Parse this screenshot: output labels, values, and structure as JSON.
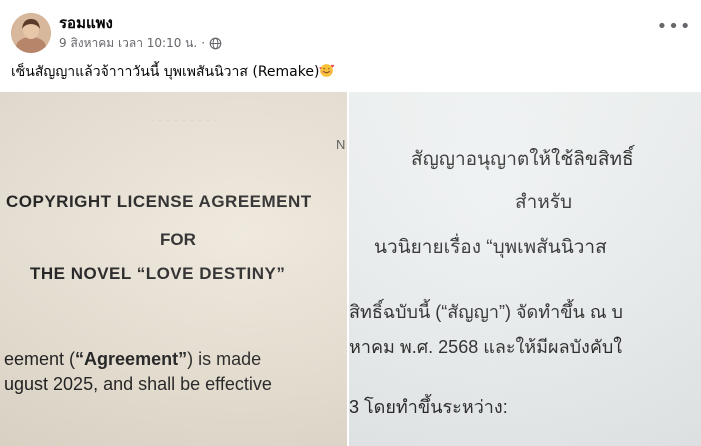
{
  "post": {
    "author": "รอมแพง",
    "timestamp": "9 สิงหาคม เวลา 10:10 น.",
    "separator": "·",
    "audience_icon": "globe-icon",
    "more_label": "•••",
    "caption": "เซ็นสัญญาแล้วจ้าาาวันนี้ บุพเพสันนิวาส (Remake)",
    "caption_emoji": "smiling-face-with-hearts"
  },
  "photos": {
    "left": {
      "corner": "N",
      "line1": "COPYRIGHT LICENSE AGREEMENT",
      "line2": "FOR",
      "line3": "THE NOVEL “LOVE DESTINY”",
      "line4_pre": "eement (",
      "line4_bold": "“Agreement”",
      "line4_post": ") is made",
      "line5": "ugust 2025, and shall be effective"
    },
    "right": {
      "line1": "สัญญาอนุญาตให้ใช้ลิขสิทธิ์",
      "line2": "สำหรับ",
      "line3": "นวนิยายเรื่อง “บุพเพสันนิวาส",
      "line4": "สิทธิ์ฉบับนี้ (“สัญญา”) จัดทำขึ้น ณ บ",
      "line5": "หาคม พ.ศ. 2568 และให้มีผลบังคับใ",
      "line6": "3 โดยทำขึ้นระหว่าง:"
    }
  },
  "colors": {
    "name_text": "#050505",
    "meta_text": "#65676b",
    "card_bg": "#ffffff",
    "left_paper": "#ece5d8",
    "right_paper": "#eceff0"
  }
}
